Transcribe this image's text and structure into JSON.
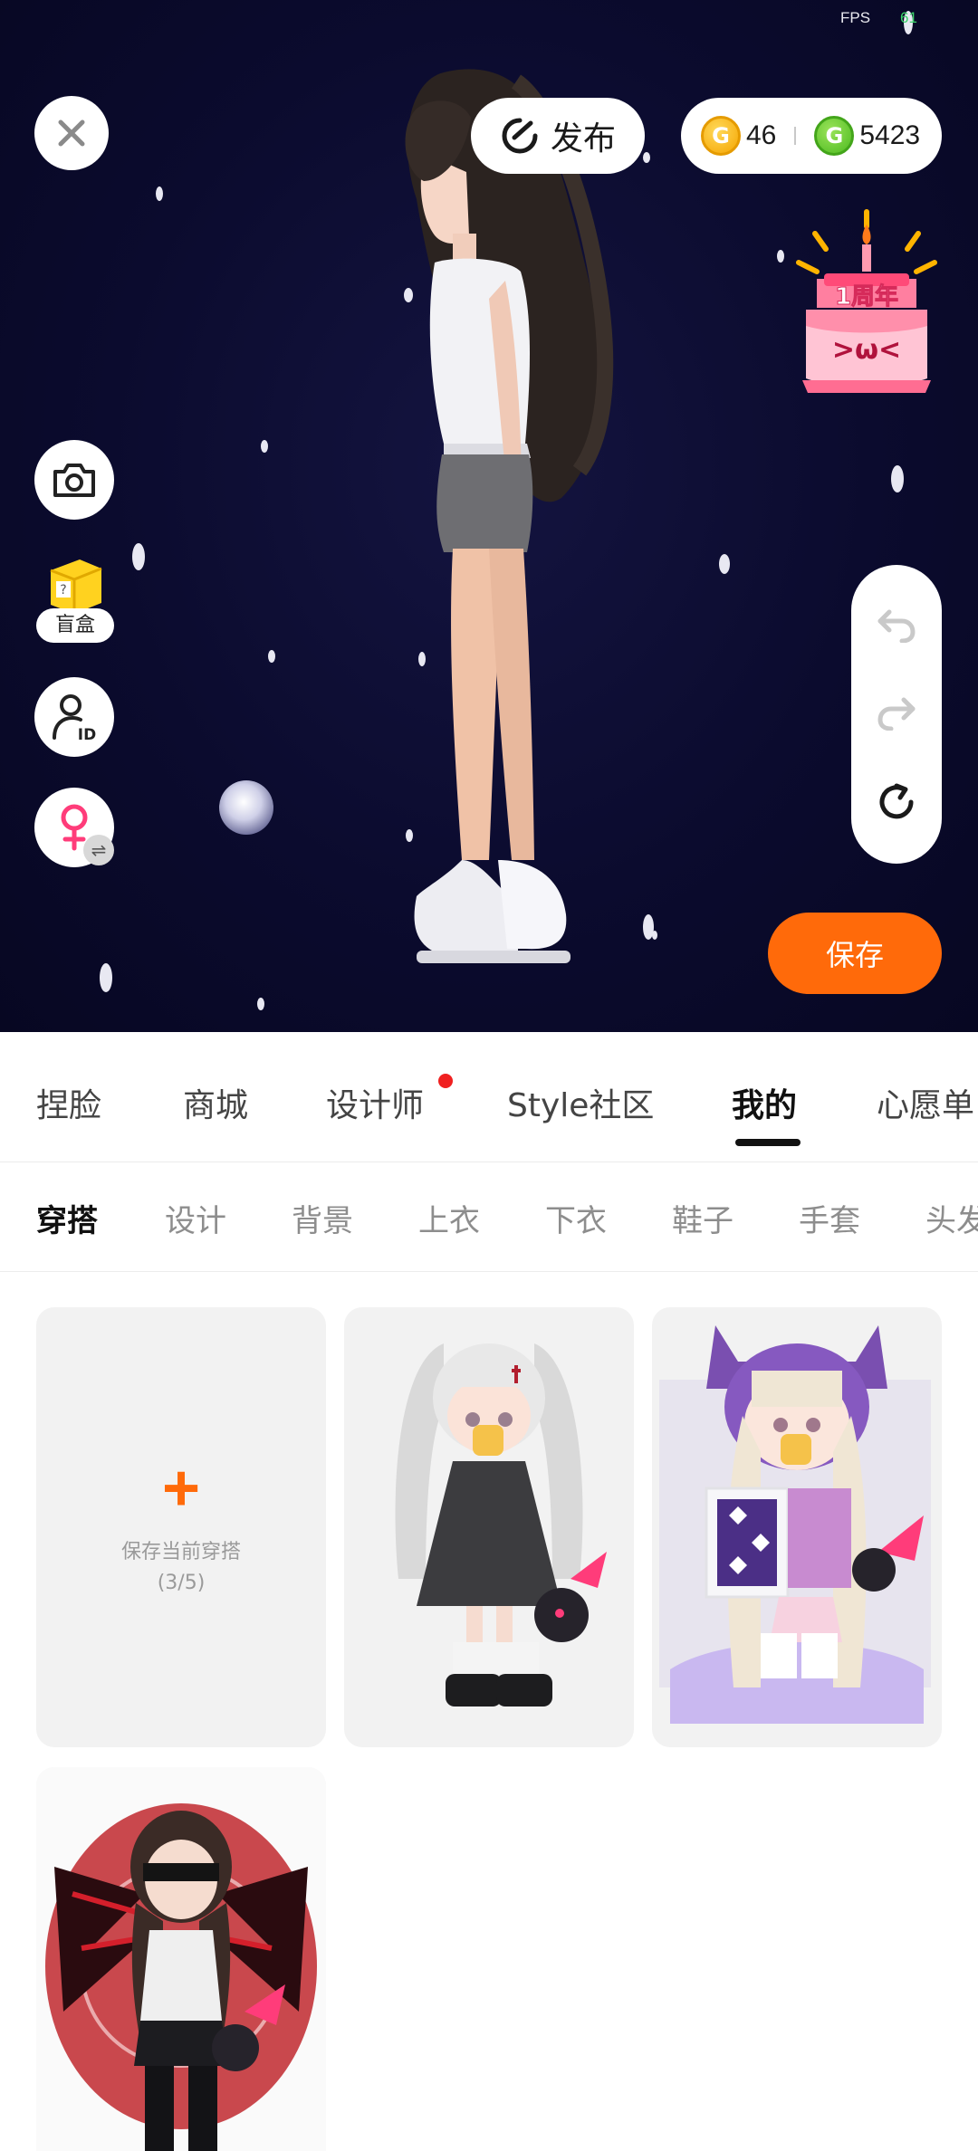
{
  "status": {
    "fps_label": "FPS",
    "fps_value": "61"
  },
  "header": {
    "publish_label": "发布",
    "currency": [
      {
        "icon": "gold-coin-icon",
        "value": "46",
        "color": "#F5A500"
      },
      {
        "icon": "green-coin-icon",
        "value": "5423",
        "color": "#4CBB1F"
      }
    ]
  },
  "anniversary_badge": {
    "text": "1周年",
    "face": ">ω<"
  },
  "side_tools": {
    "blind_box_label": "盲盒"
  },
  "save_label": "保存",
  "main_tabs": {
    "items": [
      {
        "label": "捏脸"
      },
      {
        "label": "商城"
      },
      {
        "label": "设计师"
      },
      {
        "label": "Style社区"
      },
      {
        "label": "我的"
      },
      {
        "label": "心愿单"
      }
    ],
    "active_index": 4
  },
  "sub_tabs": {
    "items": [
      {
        "label": "穿搭"
      },
      {
        "label": "设计"
      },
      {
        "label": "背景"
      },
      {
        "label": "上衣"
      },
      {
        "label": "下衣"
      },
      {
        "label": "鞋子"
      },
      {
        "label": "手套"
      },
      {
        "label": "头发"
      }
    ],
    "active_index": 0
  },
  "outfit_grid": {
    "add_card": {
      "plus": "+",
      "label": "保存当前穿搭",
      "count": "(3/5)"
    }
  },
  "colors": {
    "accent": "#FF6A0A",
    "scene_bg": "#0B0B2E",
    "notification_dot": "#F02020"
  }
}
